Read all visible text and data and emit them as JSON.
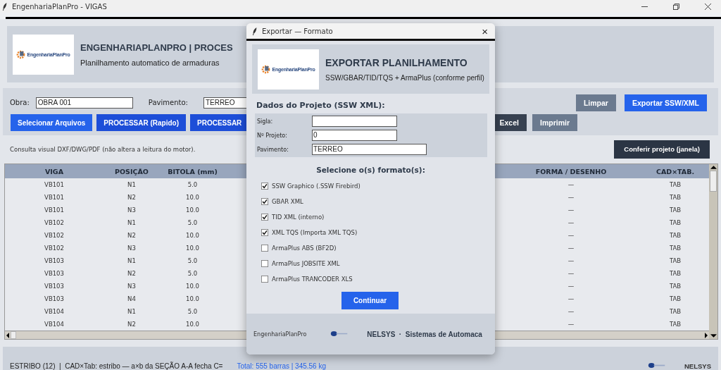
{
  "window": {
    "title": "EngenhariaPlanPro - VIGAS"
  },
  "header": {
    "logo_text": "EngenhariaPlanPro",
    "title": "ENGENHARIAPLANPRO | PROCES",
    "subtitle": "Planilhamento automatico de armaduras"
  },
  "form": {
    "fields": [
      {
        "label": "Obra:",
        "value": "OBRA 001"
      },
      {
        "label": "Pavimento:",
        "value": "TERREO"
      }
    ],
    "right_buttons": [
      {
        "label": "Limpar",
        "kind": "gray"
      },
      {
        "label": "Exportar SSW/XML",
        "kind": "blue"
      }
    ],
    "buttons": [
      {
        "label": "Selecionar Arquivos",
        "kind": "blue"
      },
      {
        "label": "PROCESSAR (Rapido)",
        "kind": "dark-blue"
      },
      {
        "label": "PROCESSAR",
        "kind": "dark-blue"
      }
    ],
    "buttons_right": [
      {
        "label": "Excel",
        "kind": "slate"
      },
      {
        "label": "Imprimir",
        "kind": "gray"
      }
    ]
  },
  "note": "Consulta visual DXF/DWG/PDF (não altera a leitura do motor).",
  "check_button": "Conferir projeto (janela)",
  "table": {
    "columns": [
      "VIGA",
      "POSIÇÃO",
      "BITOLA (mm)",
      "FORMA / DESENHO",
      "CAD×TAB."
    ],
    "rows": [
      [
        "VB101",
        "N1",
        "5.0",
        "—",
        "TAB"
      ],
      [
        "VB101",
        "N2",
        "10.0",
        "—",
        "TAB"
      ],
      [
        "VB101",
        "N3",
        "10.0",
        "—",
        "TAB"
      ],
      [
        "VB102",
        "N1",
        "5.0",
        "—",
        "TAB"
      ],
      [
        "VB102",
        "N2",
        "10.0",
        "—",
        "TAB"
      ],
      [
        "VB102",
        "N3",
        "10.0",
        "—",
        "TAB"
      ],
      [
        "VB103",
        "N1",
        "5.0",
        "—",
        "TAB"
      ],
      [
        "VB103",
        "N2",
        "5.0",
        "—",
        "TAB"
      ],
      [
        "VB103",
        "N3",
        "10.0",
        "—",
        "TAB"
      ],
      [
        "VB103",
        "N4",
        "10.0",
        "—",
        "TAB"
      ],
      [
        "VB104",
        "N1",
        "5.0",
        "—",
        "TAB"
      ],
      [
        "VB104",
        "N2",
        "10.0",
        "—",
        "TAB"
      ]
    ]
  },
  "status_bar": {
    "text": "ESTRIBO (12)  |  CAD×Tab: estribo — a×b da SEÇÃO A-A fecha C=",
    "total": "Total: 555 barras | 345.56 kg",
    "brand": "NELSYS"
  },
  "dialog": {
    "title": "Exportar — Formato",
    "close": "×",
    "logo_text": "EngenhariaPlanPro",
    "heading": "EXPORTAR PLANILHAMENTO",
    "subheading": "SSW/GBAR/TID/TQS + ArmaPlus (conforme perfil)",
    "section": "Dados do Projeto (SSW XML):",
    "fields": [
      {
        "label": "Sigla:",
        "kind": "short"
      },
      {
        "label": "Nº Projeto:",
        "value": "0",
        "kind": "short"
      },
      {
        "label": "Pavimento:",
        "value": "TERREO",
        "kind": "long"
      }
    ],
    "formats_title": "Selecione o(s) formato(s):",
    "formats": [
      {
        "label": "SSW Graphico (.SSW Firebird)",
        "checked": true
      },
      {
        "label": "GBAR XML",
        "checked": true
      },
      {
        "label": "TID XML (interno)",
        "checked": true
      },
      {
        "label": "XML TQS (Importa XML TQS)",
        "checked": true
      },
      {
        "label": "ArmaPlus ABS (BF2D)",
        "checked": false
      },
      {
        "label": "ArmaPlus JOBSITE XML",
        "checked": false
      },
      {
        "label": "ArmaPlus TRANCODER XLS",
        "checked": false
      }
    ],
    "continue": "Continuar",
    "footer_left": "EngenhariaPlanPro",
    "footer_right": "NELSYS  ·  Sistemas de Automaca"
  }
}
